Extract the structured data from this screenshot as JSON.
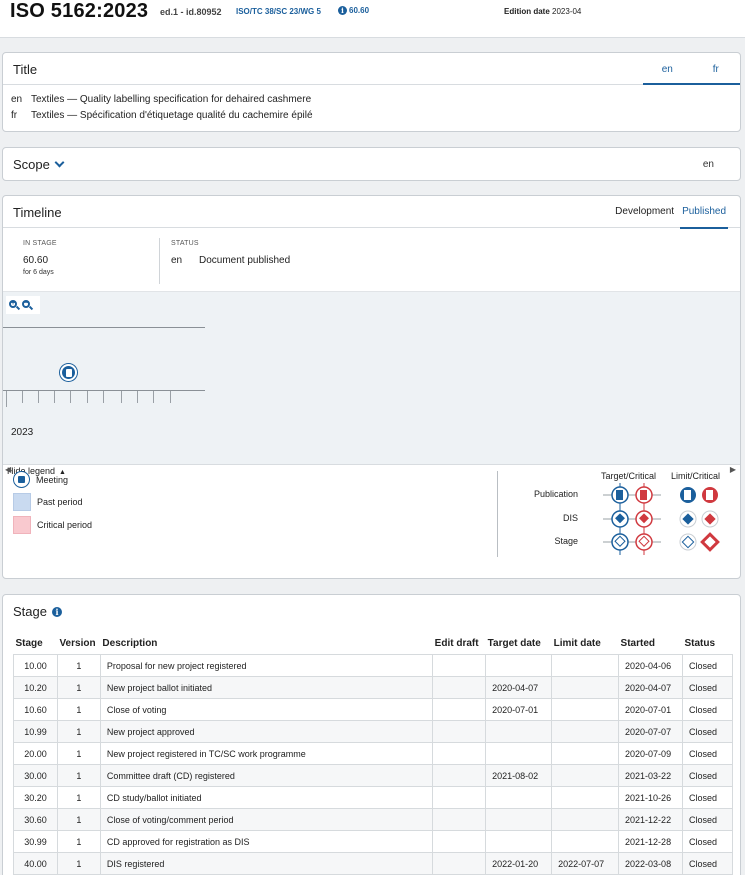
{
  "header": {
    "title": "ISO 5162:2023",
    "edition": "ed.1 - id.80952",
    "committee": "ISO/TC 38/SC 23/WG 5",
    "stage": "60.60",
    "edition_label": "Edition date",
    "edition_date": "2023-04"
  },
  "title_card": {
    "heading": "Title",
    "tabs": [
      "en",
      "fr"
    ],
    "rows": [
      {
        "lang": "en",
        "text": "Textiles — Quality labelling specification for dehaired cashmere"
      },
      {
        "lang": "fr",
        "text": "Textiles — Spécification d'étiquetage qualité du cachemire épilé"
      }
    ]
  },
  "scope_card": {
    "heading": "Scope",
    "lang": "en"
  },
  "timeline": {
    "heading": "Timeline",
    "tabs": [
      "Development",
      "Published"
    ],
    "in_stage_label": "IN STAGE",
    "in_stage_value": "60.60",
    "in_stage_duration": "for 6 days",
    "status_label": "STATUS",
    "status_lang": "en",
    "status_text": "Document published",
    "year": "2023",
    "legend_toggle": "Hide legend",
    "legend": {
      "items": [
        "Meeting",
        "Past period",
        "Critical period"
      ],
      "colors": {
        "past": "#c9daf0",
        "critical": "#f9c9cf",
        "blue": "#1b5f9c",
        "red": "#d0393f"
      },
      "col_target": "Target/Critical",
      "col_limit": "Limit/Critical",
      "rows": [
        "Publication",
        "DIS",
        "Stage"
      ]
    }
  },
  "stage_card": {
    "heading": "Stage",
    "columns": [
      "Stage",
      "Version",
      "Description",
      "Edit draft",
      "Target date",
      "Limit date",
      "Started",
      "Status"
    ],
    "rows": [
      [
        "10.00",
        "1",
        "Proposal for new project registered",
        "",
        "",
        "",
        "2020-04-06",
        "Closed"
      ],
      [
        "10.20",
        "1",
        "New project ballot initiated",
        "",
        "2020-04-07",
        "",
        "2020-04-07",
        "Closed"
      ],
      [
        "10.60",
        "1",
        "Close of voting",
        "",
        "2020-07-01",
        "",
        "2020-07-01",
        "Closed"
      ],
      [
        "10.99",
        "1",
        "New project approved",
        "",
        "",
        "",
        "2020-07-07",
        "Closed"
      ],
      [
        "20.00",
        "1",
        "New project registered in TC/SC work programme",
        "",
        "",
        "",
        "2020-07-09",
        "Closed"
      ],
      [
        "30.00",
        "1",
        "Committee draft (CD) registered",
        "",
        "2021-08-02",
        "",
        "2021-03-22",
        "Closed"
      ],
      [
        "30.20",
        "1",
        "CD study/ballot initiated",
        "",
        "",
        "",
        "2021-10-26",
        "Closed"
      ],
      [
        "30.60",
        "1",
        "Close of voting/comment period",
        "",
        "",
        "",
        "2021-12-22",
        "Closed"
      ],
      [
        "30.99",
        "1",
        "CD approved for registration as DIS",
        "",
        "",
        "",
        "2021-12-28",
        "Closed"
      ],
      [
        "40.00",
        "1",
        "DIS registered",
        "",
        "2022-01-20",
        "2022-07-07",
        "2022-03-08",
        "Closed"
      ]
    ]
  }
}
